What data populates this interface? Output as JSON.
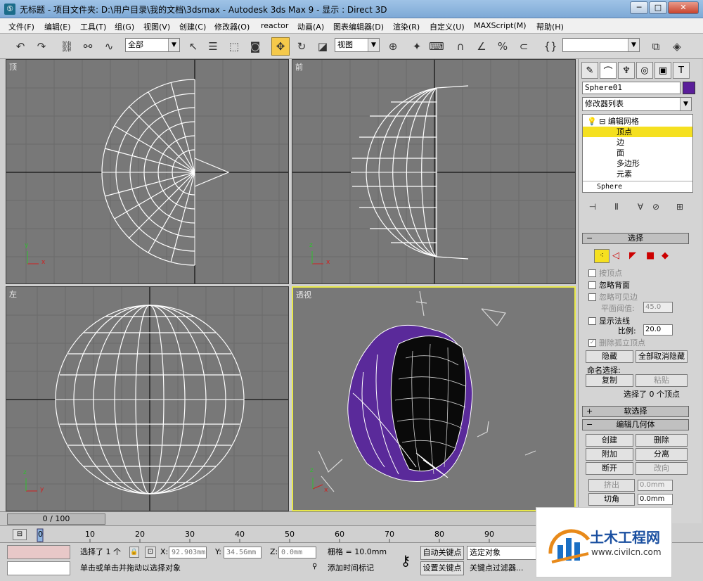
{
  "window": {
    "app_icon": "3ds-max-icon",
    "title": "无标题      - 项目文件夹: D:\\用户目录\\我的文档\\3dsmax      - Autodesk 3ds Max 9      - 显示 : Direct 3D",
    "minimize": "─",
    "maximize": "□",
    "close": "✕"
  },
  "menu": [
    "文件(F)",
    "编辑(E)",
    "工具(T)",
    "组(G)",
    "视图(V)",
    "创建(C)",
    "修改器(O)",
    "reactor",
    "动画(A)",
    "图表编辑器(D)",
    "渲染(R)",
    "自定义(U)",
    "MAXScript(M)",
    "帮助(H)"
  ],
  "toolbar": {
    "selection_filter": "全部",
    "coord_system": "视图",
    "named_selection": ""
  },
  "viewports": {
    "top": "顶",
    "front": "前",
    "left": "左",
    "perspective": "透视"
  },
  "command_panel": {
    "object_name": "Sphere01",
    "object_color": "#5a1e9a",
    "modifier_list": "修改器列表",
    "stack": {
      "edit_mesh": "编辑网格",
      "vertex": "顶点",
      "edge": "边",
      "face": "面",
      "polygon": "多边形",
      "element": "元素",
      "base": "Sphere"
    },
    "selection": {
      "header": "选择",
      "by_vertex": "按顶点",
      "ignore_backfacing": "忽略背面",
      "ignore_visible_edges": "忽略可见边",
      "planar_threshold_label": "平面阈值:",
      "planar_threshold": "45.0",
      "show_normals": "显示法线",
      "scale_label": "比例:",
      "scale": "20.0",
      "delete_isolated": "删除孤立顶点",
      "hide": "隐藏",
      "unhide_all": "全部取消隐藏",
      "named_selection_label": "命名选择:",
      "copy": "复制",
      "paste": "粘贴",
      "status": "选择了 0 个顶点"
    },
    "soft_selection": "软选择",
    "edit_geometry": {
      "header": "编辑几何体",
      "create": "创建",
      "delete": "删除",
      "attach": "附加",
      "detach": "分离",
      "break": "断开",
      "turn": "改向",
      "extrude": "挤出",
      "extrude_value": "0.0mm",
      "chamfer": "切角",
      "chamfer_value": "0.0mm"
    }
  },
  "timeline": {
    "frame": "0 / 100",
    "ticks": [
      "0",
      "10",
      "20",
      "30",
      "40",
      "50",
      "60",
      "70",
      "80",
      "90"
    ]
  },
  "status": {
    "selected": "选择了 1 个",
    "x_label": "X:",
    "x": "92.903mm",
    "y_label": "Y:",
    "y": "34.56mm",
    "z_label": "Z:",
    "z": "0.0mm",
    "grid": "栅格 = 10.0mm",
    "auto_key": "自动关键点",
    "selected_objects": "选定对象",
    "set_key": "设置关键点",
    "key_filters": "关键点过滤器...",
    "prompt": "单击或单击并拖动以选择对象",
    "add_time_tag": "添加时间标记"
  },
  "watermark": {
    "name": "土木工程网",
    "url": "www.civilcn.com"
  }
}
